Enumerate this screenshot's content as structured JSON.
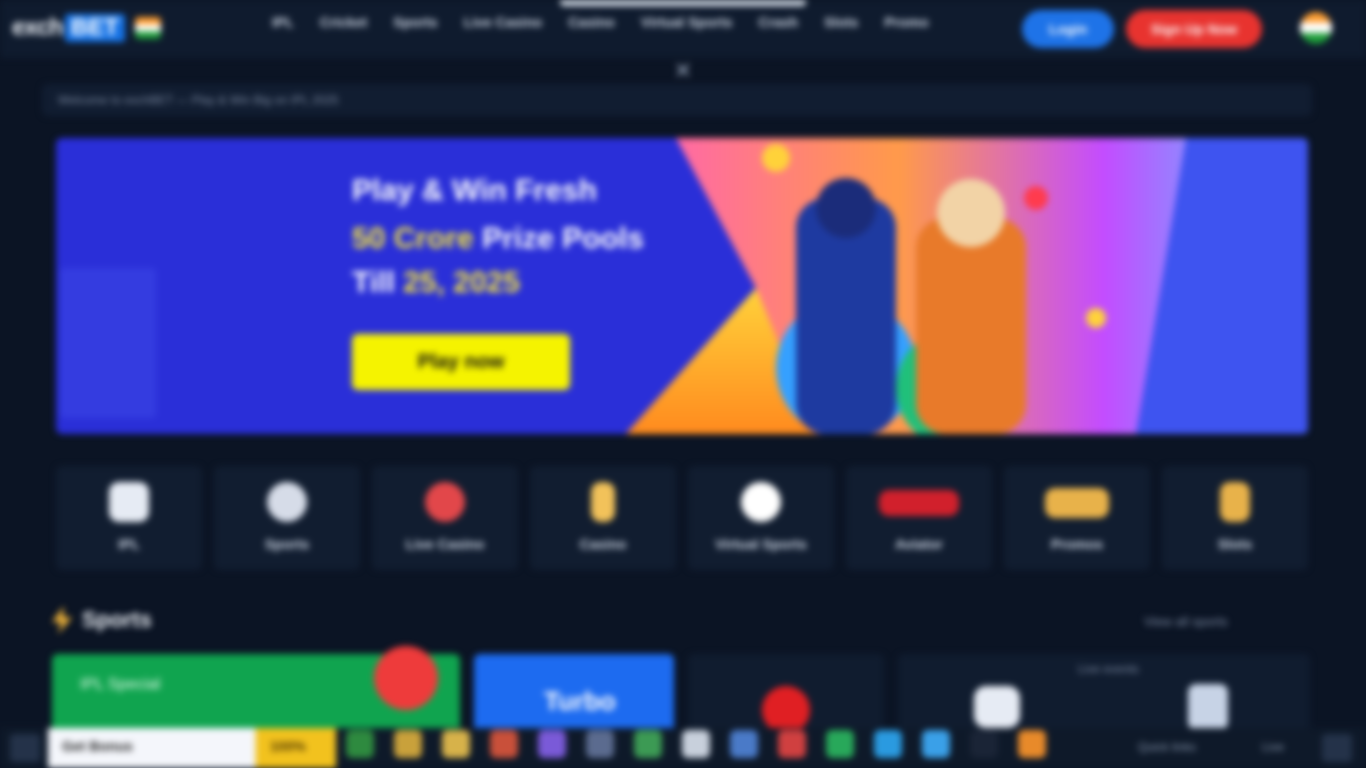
{
  "header": {
    "logo_part1": "exch",
    "logo_part2": "BET",
    "nav": [
      "IPL",
      "Cricket",
      "Sports",
      "Live Casino",
      "Casino",
      "Virtual Sports",
      "Crash",
      "Slots",
      "Promo"
    ],
    "login_label": "Login",
    "signup_label": "Sign Up Now"
  },
  "marquee": {
    "text": "Welcome to exchBET — Play & Win Big on IPL 2025"
  },
  "banner": {
    "line1": "Play & Win Fresh",
    "line2_highlight": "50 Crore",
    "line2_rest": " Prize Pools",
    "line3_rest": "Till ",
    "line3_highlight": "25, 2025",
    "cta_label": "Play now",
    "colors": {
      "background": "#2a2fd8",
      "cta": "#f5f300",
      "highlight": "#f8e93a"
    }
  },
  "categories": [
    {
      "label": "IPL",
      "icon": "cricket-bat-icon",
      "color": "#e6ebf4"
    },
    {
      "label": "Sports",
      "icon": "soccer-ball-icon",
      "color": "#d6dce8"
    },
    {
      "label": "Live Casino",
      "icon": "roulette-icon",
      "color": "#e2474a"
    },
    {
      "label": "Casino",
      "icon": "dice-icon",
      "color": "#f2c25a"
    },
    {
      "label": "Virtual Sports",
      "icon": "virtual-ball-icon",
      "color": "#ffffff"
    },
    {
      "label": "Aviator",
      "icon": "plane-icon",
      "color": "#d1202c"
    },
    {
      "label": "Promos",
      "icon": "gift-icon",
      "color": "#e8b24a"
    },
    {
      "label": "Slots",
      "icon": "slot-icon",
      "color": "#e8b24a"
    }
  ],
  "sports_section": {
    "title": "Sports",
    "see_all": "View all sports"
  },
  "cards": {
    "card1_text": "IPL Special",
    "card2_text": "Turbo",
    "card4_text": "Live events"
  },
  "bottom_bar": {
    "promo_text": "Get Bonus",
    "promo_highlight": "100%",
    "right_text": "Quick links",
    "time": "Live"
  }
}
